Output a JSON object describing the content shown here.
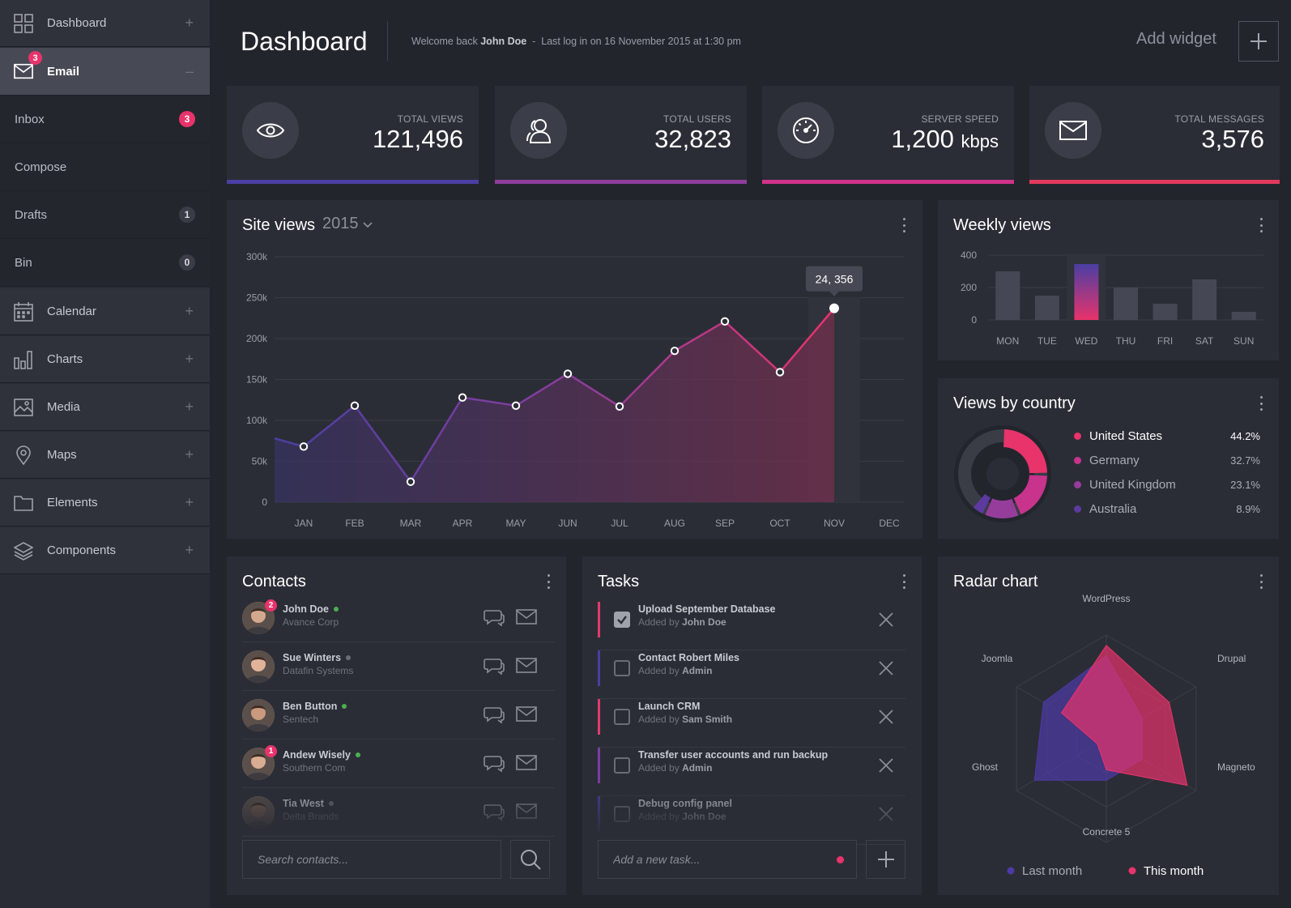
{
  "sidebar": {
    "items": [
      {
        "label": "Dashboard",
        "icon": "dashboard-icon",
        "toggle": "+"
      },
      {
        "label": "Email",
        "icon": "envelope-icon",
        "toggle": "–",
        "badge": "3"
      },
      {
        "label": "Calendar",
        "icon": "calendar-icon",
        "toggle": "+"
      },
      {
        "label": "Charts",
        "icon": "charts-icon",
        "toggle": "+"
      },
      {
        "label": "Media",
        "icon": "image-icon",
        "toggle": "+"
      },
      {
        "label": "Maps",
        "icon": "map-pin-icon",
        "toggle": "+"
      },
      {
        "label": "Elements",
        "icon": "folder-icon",
        "toggle": "+"
      },
      {
        "label": "Components",
        "icon": "layers-icon",
        "toggle": "+"
      }
    ],
    "email_sub": [
      {
        "label": "Inbox",
        "count": "3"
      },
      {
        "label": "Compose",
        "count": ""
      },
      {
        "label": "Drafts",
        "count": "1"
      },
      {
        "label": "Bin",
        "count": "0"
      }
    ]
  },
  "header": {
    "title": "Dashboard",
    "welcome_prefix": "Welcome back",
    "user": "John Doe",
    "last_login": "Last log in on 16 November 2015 at 1:30 pm",
    "add_widget": "Add widget"
  },
  "stats": [
    {
      "label": "TOTAL VIEWS",
      "value": "121,496",
      "unit": "",
      "icon": "eye-icon",
      "color": "#4a3fa3"
    },
    {
      "label": "TOTAL USERS",
      "value": "32,823",
      "unit": "",
      "icon": "users-icon",
      "color": "#8e3d9c"
    },
    {
      "label": "SERVER SPEED",
      "value": "1,200",
      "unit": "kbps",
      "icon": "speedometer-icon",
      "color": "#d0338a"
    },
    {
      "label": "TOTAL MESSAGES",
      "value": "3,576",
      "unit": "",
      "icon": "envelope-icon",
      "color": "#e23a5e"
    }
  ],
  "site_views": {
    "title": "Site views",
    "year": "2015",
    "tooltip": "24, 356"
  },
  "weekly_views": {
    "title": "Weekly views"
  },
  "country": {
    "title": "Views by country"
  },
  "contacts": {
    "title": "Contacts",
    "search_placeholder": "Search contacts...",
    "list": [
      {
        "name": "John Doe",
        "company": "Avance Corp",
        "status": "online",
        "badge": "2"
      },
      {
        "name": "Sue Winters",
        "company": "Datafin Systems",
        "status": "offline",
        "badge": ""
      },
      {
        "name": "Ben Button",
        "company": "Sentech",
        "status": "online",
        "badge": ""
      },
      {
        "name": "Andew Wisely",
        "company": "Southern Com",
        "status": "online",
        "badge": "1"
      },
      {
        "name": "Tia West",
        "company": "Delta Brands",
        "status": "offline",
        "badge": ""
      }
    ]
  },
  "tasks": {
    "title": "Tasks",
    "add_placeholder": "Add a new task...",
    "added_by_prefix": "Added by",
    "list": [
      {
        "name": "Upload September Database",
        "by": "John Doe",
        "done": true,
        "color": "#e23a6b"
      },
      {
        "name": "Contact Robert Miles",
        "by": "Admin",
        "done": false,
        "color": "#4a3fa3"
      },
      {
        "name": "Launch CRM",
        "by": "Sam Smith",
        "done": false,
        "color": "#e23a6b"
      },
      {
        "name": "Transfer user accounts and run backup",
        "by": "Admin",
        "done": false,
        "color": "#7a3fa3"
      },
      {
        "name": "Debug config panel",
        "by": "John Doe",
        "done": false,
        "color": "#4a3fa3"
      }
    ]
  },
  "radar": {
    "title": "Radar chart"
  },
  "chart_data": [
    {
      "type": "area",
      "title": "Site views",
      "categories": [
        "JAN",
        "FEB",
        "MAR",
        "APR",
        "MAY",
        "JUN",
        "JUL",
        "AUG",
        "SEP",
        "OCT",
        "NOV",
        "DEC"
      ],
      "values": [
        68000,
        118000,
        25000,
        128000,
        118000,
        157000,
        117000,
        185000,
        221000,
        159000,
        237000,
        null
      ],
      "start_value": 78000,
      "yticks": [
        "0",
        "50k",
        "100k",
        "150k",
        "200k",
        "250k",
        "300k"
      ],
      "ylim": [
        0,
        300000
      ],
      "highlight": {
        "category": "NOV",
        "label": "24, 356"
      },
      "grid": true
    },
    {
      "type": "bar",
      "title": "Weekly views",
      "categories": [
        "MON",
        "TUE",
        "WED",
        "THU",
        "FRI",
        "SAT",
        "SUN"
      ],
      "values": [
        300,
        150,
        345,
        200,
        100,
        250,
        50
      ],
      "yticks": [
        "0",
        "200",
        "400"
      ],
      "ylim": [
        0,
        400
      ],
      "highlight": "WED"
    },
    {
      "type": "pie",
      "title": "Views by country",
      "slices": [
        {
          "name": "United States",
          "value": 44.2,
          "label": "44.2%",
          "color": "#e8336b"
        },
        {
          "name": "Germany",
          "value": 32.7,
          "label": "32.7%",
          "color": "#c8338c"
        },
        {
          "name": "United Kingdom",
          "value": 23.1,
          "label": "23.1%",
          "color": "#963d9c"
        },
        {
          "name": "Australia",
          "value": 8.9,
          "label": "8.9%",
          "color": "#5c3aa0"
        }
      ]
    },
    {
      "type": "radar",
      "title": "Radar chart",
      "axes": [
        "WordPress",
        "Drupal",
        "Magneto",
        "Concrete 5",
        "Ghost",
        "Joomla"
      ],
      "series": [
        {
          "name": "Last month",
          "values": [
            0.8,
            0.4,
            0.4,
            0.4,
            0.8,
            0.7
          ],
          "color": "#4d3aa6"
        },
        {
          "name": "This month",
          "values": [
            0.9,
            0.7,
            0.9,
            0.3,
            0.1,
            0.5
          ],
          "color": "#e8336b"
        }
      ]
    }
  ]
}
